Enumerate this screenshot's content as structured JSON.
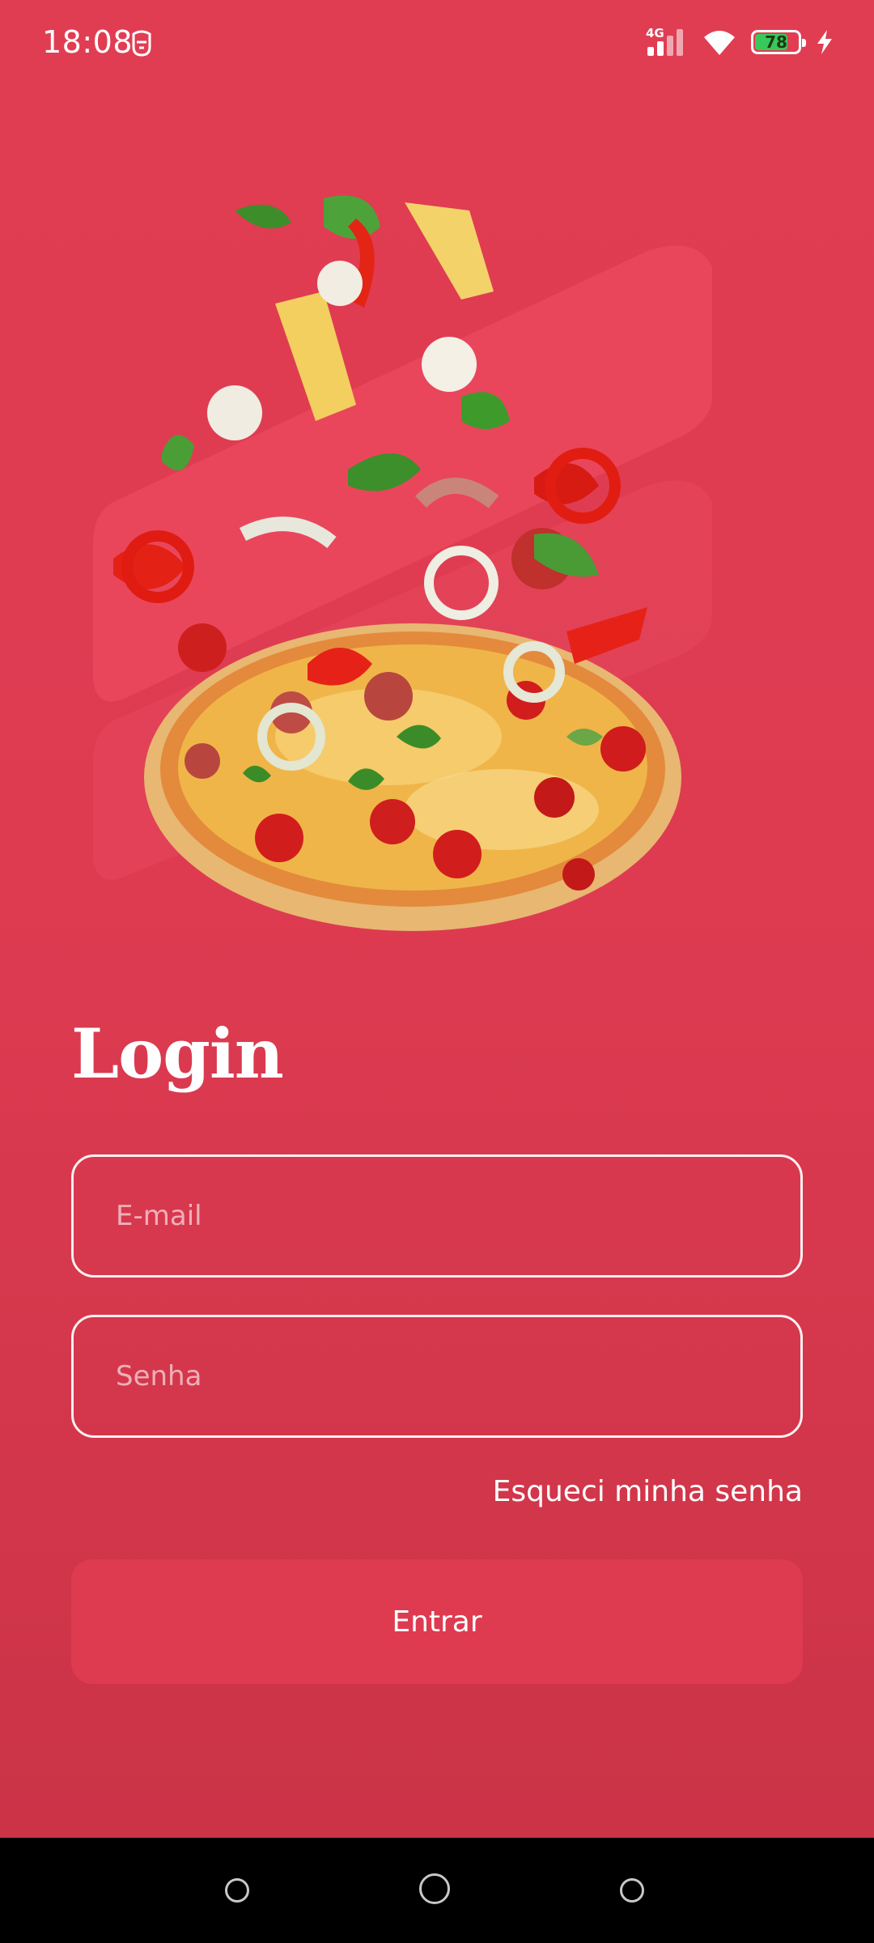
{
  "status_bar": {
    "time": "18:08",
    "network_type": "4G",
    "battery_level": "78",
    "battery_fraction": 0.78,
    "icons": [
      "notification-icon",
      "signal-icon",
      "wifi-icon",
      "battery-icon",
      "charging-icon"
    ]
  },
  "hero": {
    "icon": "pizza-illustration"
  },
  "login": {
    "title": "Login",
    "email_placeholder": "E-mail",
    "password_placeholder": "Senha",
    "forgot_password": "Esqueci minha senha",
    "submit_label": "Entrar"
  },
  "nav": {
    "icons": [
      "recent-apps-icon",
      "home-icon",
      "back-icon"
    ]
  },
  "colors": {
    "background": "#de3b51",
    "button": "#de3a50",
    "text": "#ffffff"
  }
}
